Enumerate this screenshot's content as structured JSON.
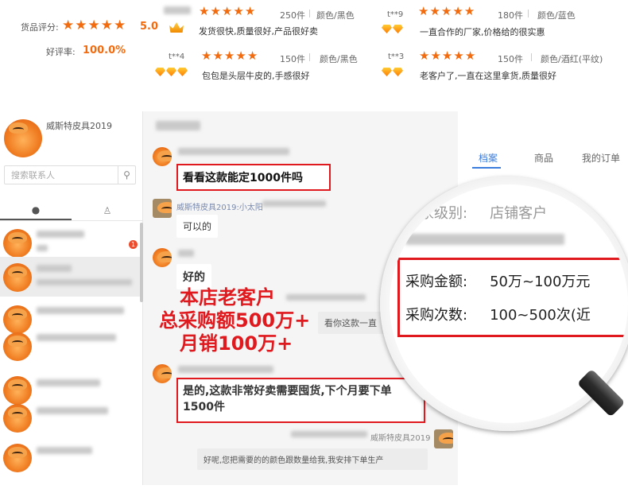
{
  "reviews": {
    "score_label": "货品评分:",
    "score_value": "5.0",
    "rate_label": "好评率:",
    "rate_value": "100.0%",
    "items": [
      {
        "user": "",
        "count": "250件",
        "color": "颜色/黑色",
        "text": "发货很快,质量很好,产品很好卖",
        "badge": "crown"
      },
      {
        "user": "t**9",
        "count": "180件",
        "color": "颜色/蓝色",
        "text": "一直合作的厂家,价格给的很实惠",
        "badge": "gems2"
      },
      {
        "user": "t**4",
        "count": "150件",
        "color": "颜色/黑色",
        "text": "包包是头层牛皮的,手感很好",
        "badge": "gems3"
      },
      {
        "user": "t**3",
        "count": "150件",
        "color": "颜色/酒红(平纹)",
        "text": "老客户了,一直在这里拿货,质量很好",
        "badge": "gems2"
      }
    ]
  },
  "sidebar": {
    "shop_name": "威斯特皮具2019",
    "search_placeholder": "搜索联系人",
    "unread": "1"
  },
  "chat": {
    "msg1": "看看这款能定1000件吗",
    "reply_name": "威斯特皮具2019:小太阳",
    "msg2": "可以的",
    "msg3": "好的",
    "side_snippet": "看你这款一直",
    "msg4": "是的,这款非常好卖需要囤货,下个月要下单1500件",
    "seller_name": "威斯特皮具2019",
    "msg5": "好呢,您把需要的的颜色跟数量给我,我安排下单生产"
  },
  "overlay": {
    "line1": "本店老客户",
    "line2": "总采购额500万+",
    "line3": "月销100万+"
  },
  "right_panel": {
    "tabs": [
      "档案",
      "商品",
      "我的订单"
    ]
  },
  "lens": {
    "row_top_label": "买家级别:",
    "row_top_value": "店铺客户",
    "amount_label": "采购金额:",
    "amount_value": "50万~100万元",
    "times_label": "采购次数:",
    "times_value": "100~500次(近"
  },
  "colors": {
    "accent": "#f26b0f",
    "red": "#e0191e",
    "tab_active": "#3a7ddc"
  }
}
